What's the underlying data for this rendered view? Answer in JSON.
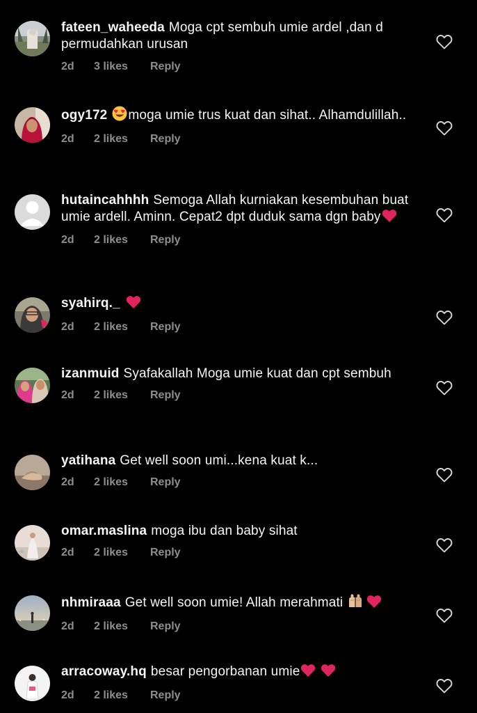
{
  "comments": [
    {
      "username": "fateen_waheeda",
      "text": "Moga cpt sembuh umie ardel ,dan d permudahkan urusan",
      "time": "2d",
      "likes": "3 likes",
      "reply": "Reply",
      "avatar": "photo-outdoor"
    },
    {
      "username": "ogy172",
      "text": "moga umie trus kuat dan sihat.. Alhamdulillah..",
      "time": "2d",
      "likes": "2 likes",
      "reply": "Reply",
      "avatar": "photo-red-hijab",
      "emoji_before": "heart-eyes-emoji"
    },
    {
      "username": "hutaincahhhh",
      "text": "Semoga Allah kurniakan kesembuhan buat umie ardell. Aminn. Cepat2 dpt duduk sama dgn baby",
      "time": "2d",
      "likes": "2 likes",
      "reply": "Reply",
      "avatar": "default-avatar",
      "emoji_after": "red-heart-emoji"
    },
    {
      "username": "syahirq._",
      "text": "",
      "time": "2d",
      "likes": "2 likes",
      "reply": "Reply",
      "avatar": "photo-glasses",
      "emoji_after": "red-heart-emoji"
    },
    {
      "username": "izanmuid",
      "text": "Syafakallah Moga umie kuat dan cpt sembuh",
      "time": "2d",
      "likes": "2 likes",
      "reply": "Reply",
      "avatar": "photo-two-women"
    },
    {
      "username": "yatihana",
      "text": "Get well soon umi...kena kuat k...",
      "time": "2d",
      "likes": "2 likes",
      "reply": "Reply",
      "avatar": "photo-hand"
    },
    {
      "username": "omar.maslina",
      "text": "moga ibu dan baby sihat",
      "time": "2d",
      "likes": "2 likes",
      "reply": "Reply",
      "avatar": "photo-light-dress"
    },
    {
      "username": "nhmiraaa",
      "text": "Get well soon umie! Allah merahmati",
      "time": "2d",
      "likes": "2 likes",
      "reply": "Reply",
      "avatar": "photo-sunset",
      "emoji_after": "praying-hands-emoji red-heart-emoji"
    },
    {
      "username": "arracoway.hq",
      "text": "besar pengorbanan umie",
      "time": "2d",
      "likes": "2 likes",
      "reply": "Reply",
      "avatar": "photo-white-figure",
      "emoji_after": "red-heart-emoji red-heart-emoji"
    }
  ],
  "icons": {
    "like": "heart-outline-icon"
  },
  "colors": {
    "background": "#000000",
    "text": "#f5f5f5",
    "meta": "#8e8e8e",
    "heart_emoji": "#e0245e"
  }
}
